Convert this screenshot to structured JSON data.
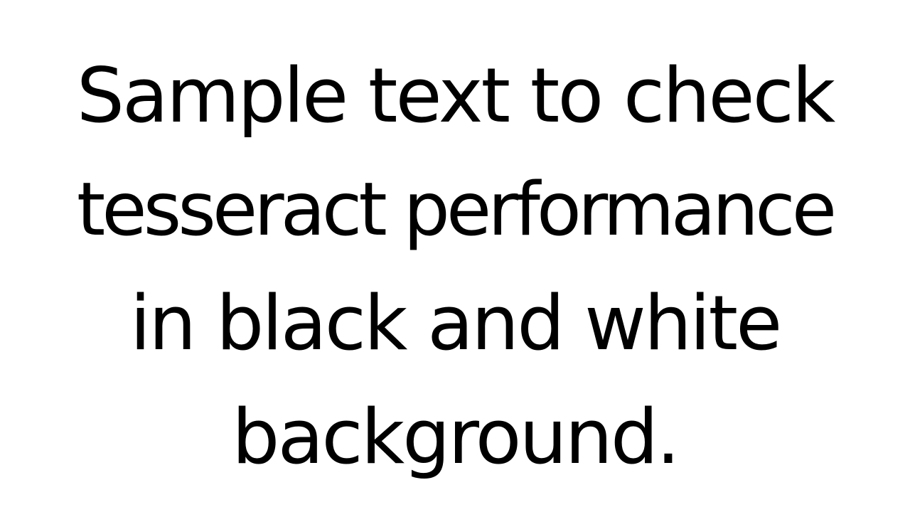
{
  "document": {
    "lines": [
      "Sample text to check",
      "tesseract performance",
      "in black and white",
      "background."
    ]
  },
  "colors": {
    "background": "#ffffff",
    "text": "#000000"
  }
}
